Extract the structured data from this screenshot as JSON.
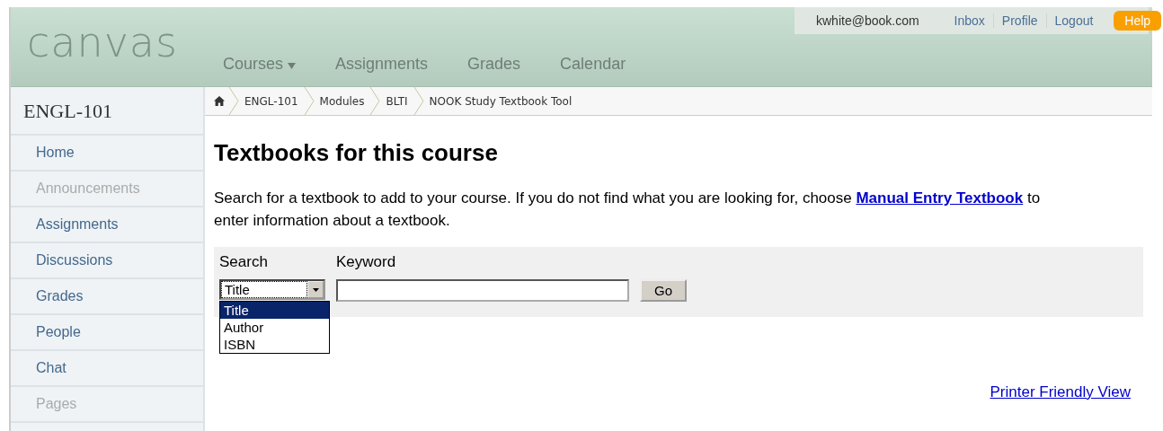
{
  "header": {
    "logo": "canvas",
    "nav": [
      {
        "label": "Courses",
        "dropdown": true
      },
      {
        "label": "Assignments",
        "dropdown": false
      },
      {
        "label": "Grades",
        "dropdown": false
      },
      {
        "label": "Calendar",
        "dropdown": false
      }
    ],
    "user": {
      "email": "kwhite@book.com",
      "links": [
        "Inbox",
        "Profile",
        "Logout"
      ],
      "help": "Help"
    }
  },
  "breadcrumbs": [
    "ENGL-101",
    "Modules",
    "BLTI",
    "NOOK Study Textbook Tool"
  ],
  "sidebar": {
    "course": "ENGL-101",
    "items": [
      {
        "label": "Home",
        "disabled": false
      },
      {
        "label": "Announcements",
        "disabled": true
      },
      {
        "label": "Assignments",
        "disabled": false
      },
      {
        "label": "Discussions",
        "disabled": false
      },
      {
        "label": "Grades",
        "disabled": false
      },
      {
        "label": "People",
        "disabled": false
      },
      {
        "label": "Chat",
        "disabled": false
      },
      {
        "label": "Pages",
        "disabled": true
      }
    ]
  },
  "main": {
    "title": "Textbooks for this course",
    "intro": "Search for a textbook to add to your course. If you do not find what you are looking for, choose",
    "intro_link": "Manual Entry Textbook",
    "intro_end": "to enter information about a textbook.",
    "search": {
      "search_label": "Search",
      "keyword_label": "Keyword",
      "select_value": "Title",
      "options": [
        {
          "label": "Title",
          "selected": true
        },
        {
          "label": "Author",
          "selected": false
        },
        {
          "label": "ISBN",
          "selected": false
        }
      ],
      "button": "Go"
    },
    "printer_link": "Printer Friendly View"
  }
}
